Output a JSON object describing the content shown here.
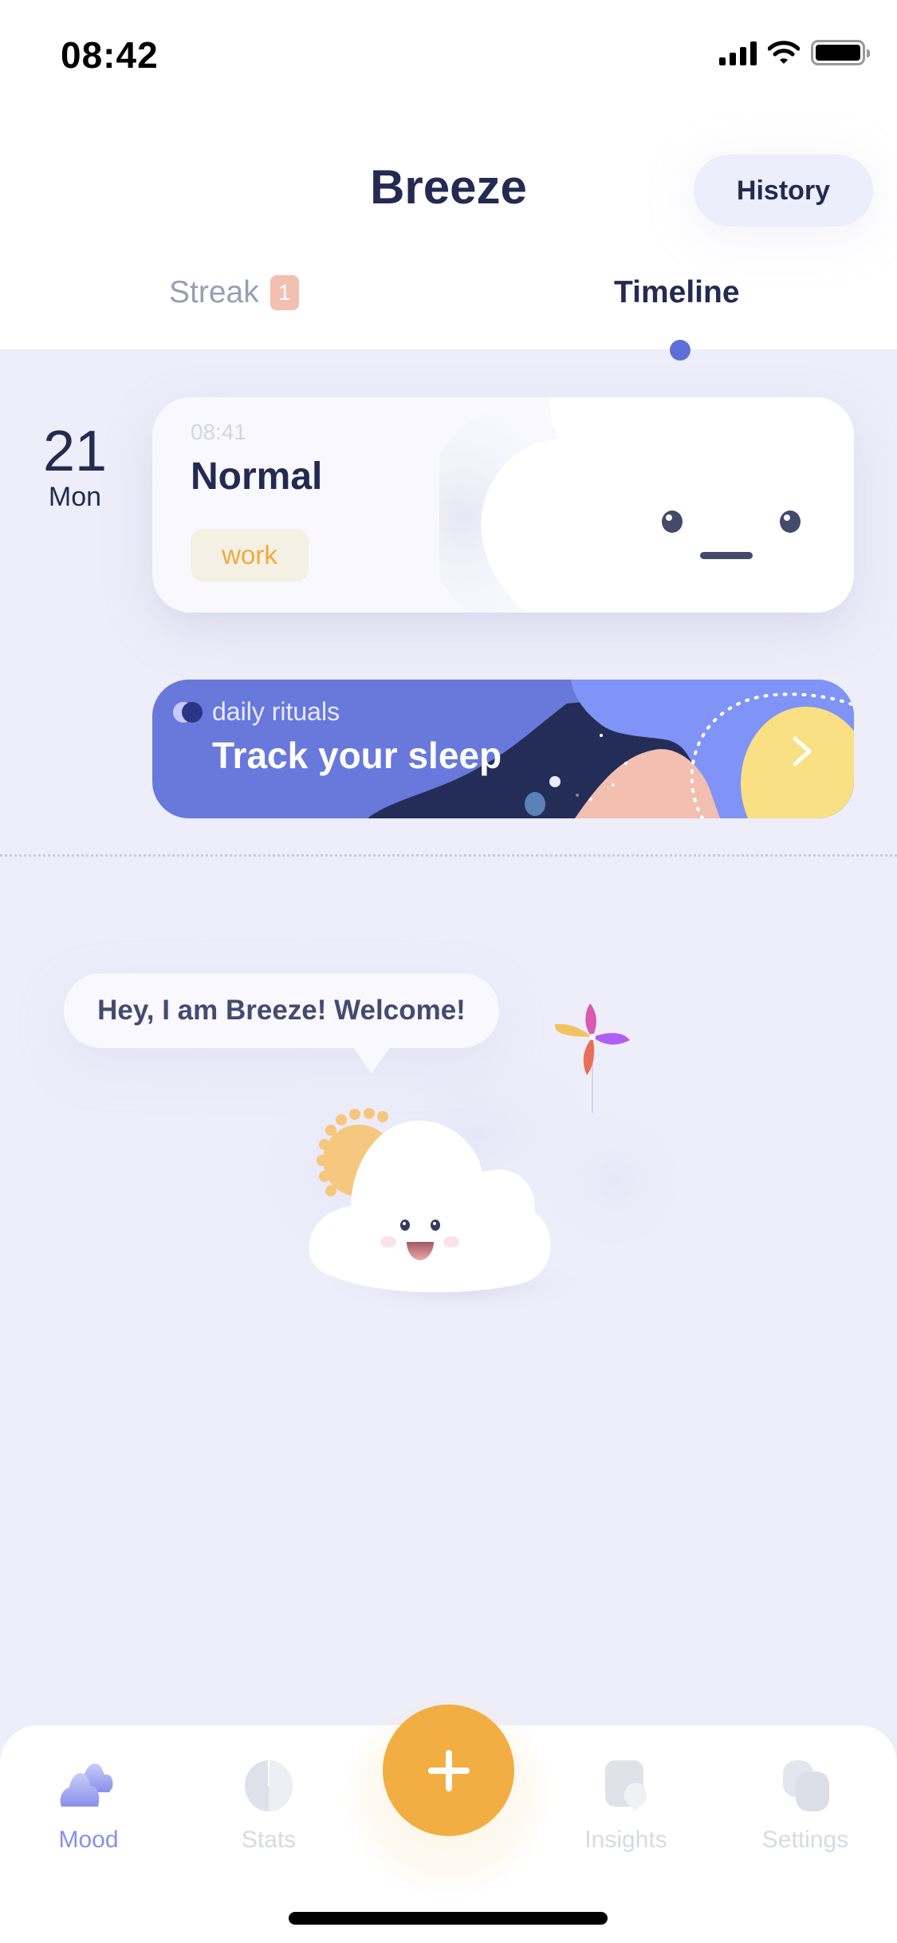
{
  "status_bar": {
    "time": "08:42"
  },
  "header": {
    "title": "Breeze",
    "history_label": "History"
  },
  "tabs": [
    {
      "label": "Streak",
      "badge": "1",
      "active": false
    },
    {
      "label": "Timeline",
      "active": true
    }
  ],
  "timeline": {
    "date": {
      "day": "21",
      "weekday": "Mon"
    },
    "entry": {
      "time": "08:41",
      "mood": "Normal",
      "tags": [
        "work"
      ]
    }
  },
  "ritual_banner": {
    "subtitle": "daily rituals",
    "title": "Track your sleep"
  },
  "mascot": {
    "greeting": "Hey, I am Breeze! Welcome!"
  },
  "bottom_nav": {
    "items": [
      {
        "label": "Mood",
        "icon": "cloud-icon",
        "active": true
      },
      {
        "label": "Stats",
        "icon": "pie-chart-icon",
        "active": false
      },
      {
        "label": "Insights",
        "icon": "insights-icon",
        "active": false
      },
      {
        "label": "Settings",
        "icon": "settings-icon",
        "active": false
      }
    ],
    "add_label": "+"
  },
  "colors": {
    "accent": "#5f6ed8",
    "background": "#eeeefa",
    "text_dark": "#252a52",
    "fab": "#f2ae42",
    "tag_text": "#f0a93d",
    "streak_badge": "#f3bfb0",
    "banner": "#6878db"
  }
}
